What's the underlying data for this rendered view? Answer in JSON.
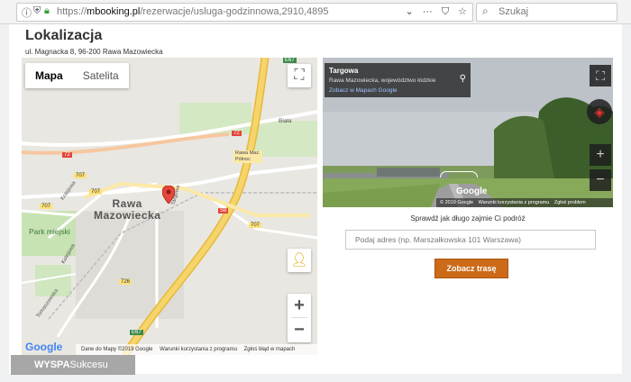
{
  "browser": {
    "url_scheme": "https://",
    "url_host": "mbooking.pl",
    "url_path": "/rezerwacje/usluga-godzinnowa,2910,4895",
    "search_placeholder": "Szukaj"
  },
  "page": {
    "title": "Lokalizacja",
    "address": "ul. Magnacka 8, 96-200 Rawa Mazowiecka"
  },
  "map": {
    "tab_map": "Mapa",
    "tab_satellite": "Satelita",
    "labels": {
      "city_line1": "Rawa",
      "city_line2": "Mazowiecka",
      "park": "Park miejski",
      "biala": "Biała",
      "rawa_polnoc_1": "Rawa Maz.",
      "rawa_polnoc_2": "Północ",
      "kolejowa": "Kolejowa",
      "kolejowa2": "Kolejowa",
      "tomaszowska": "Tomaszowska",
      "targowa": "Targowa"
    },
    "road_numbers": {
      "e67_top": "E67",
      "r72_left": "72",
      "r72_mid": "72",
      "r707_left": "707",
      "r707_a": "707",
      "r707_b": "707",
      "r707_right": "707",
      "s8": "S8",
      "r726": "726",
      "e67_bottom": "E67"
    },
    "footer": {
      "data": "Dane do Mapy ©2019 Google",
      "terms": "Warunki korzystania z programu",
      "report": "Zgłoś błąd w mapach"
    },
    "google_logo": "Google",
    "zoom_in": "+",
    "zoom_out": "−"
  },
  "street_view": {
    "title": "Targowa",
    "subtitle": "Rawa Mazowiecka, województwo łódzkie",
    "link": "Zobacz w Mapach Google",
    "google_logo": "Google",
    "footer": {
      "copyright": "© 2019 Google",
      "terms": "Warunki korzystania z programu",
      "report": "Zgłoś problem"
    },
    "zoom_in": "+",
    "zoom_out": "−"
  },
  "route": {
    "hint": "Sprawdź jak długo zajmie Ci podróż",
    "input_placeholder": "Podaj adres (np. Marszałkowska 101 Warszawa)",
    "button": "Zobacz trasę"
  },
  "watermark": {
    "bold": "WYSPA",
    "rest": "Sukcesu"
  },
  "colors": {
    "accent_button": "#cc6a18",
    "highway": "#f5d56b",
    "map_bg": "#e9e7e1",
    "marker": "#e5473a"
  }
}
